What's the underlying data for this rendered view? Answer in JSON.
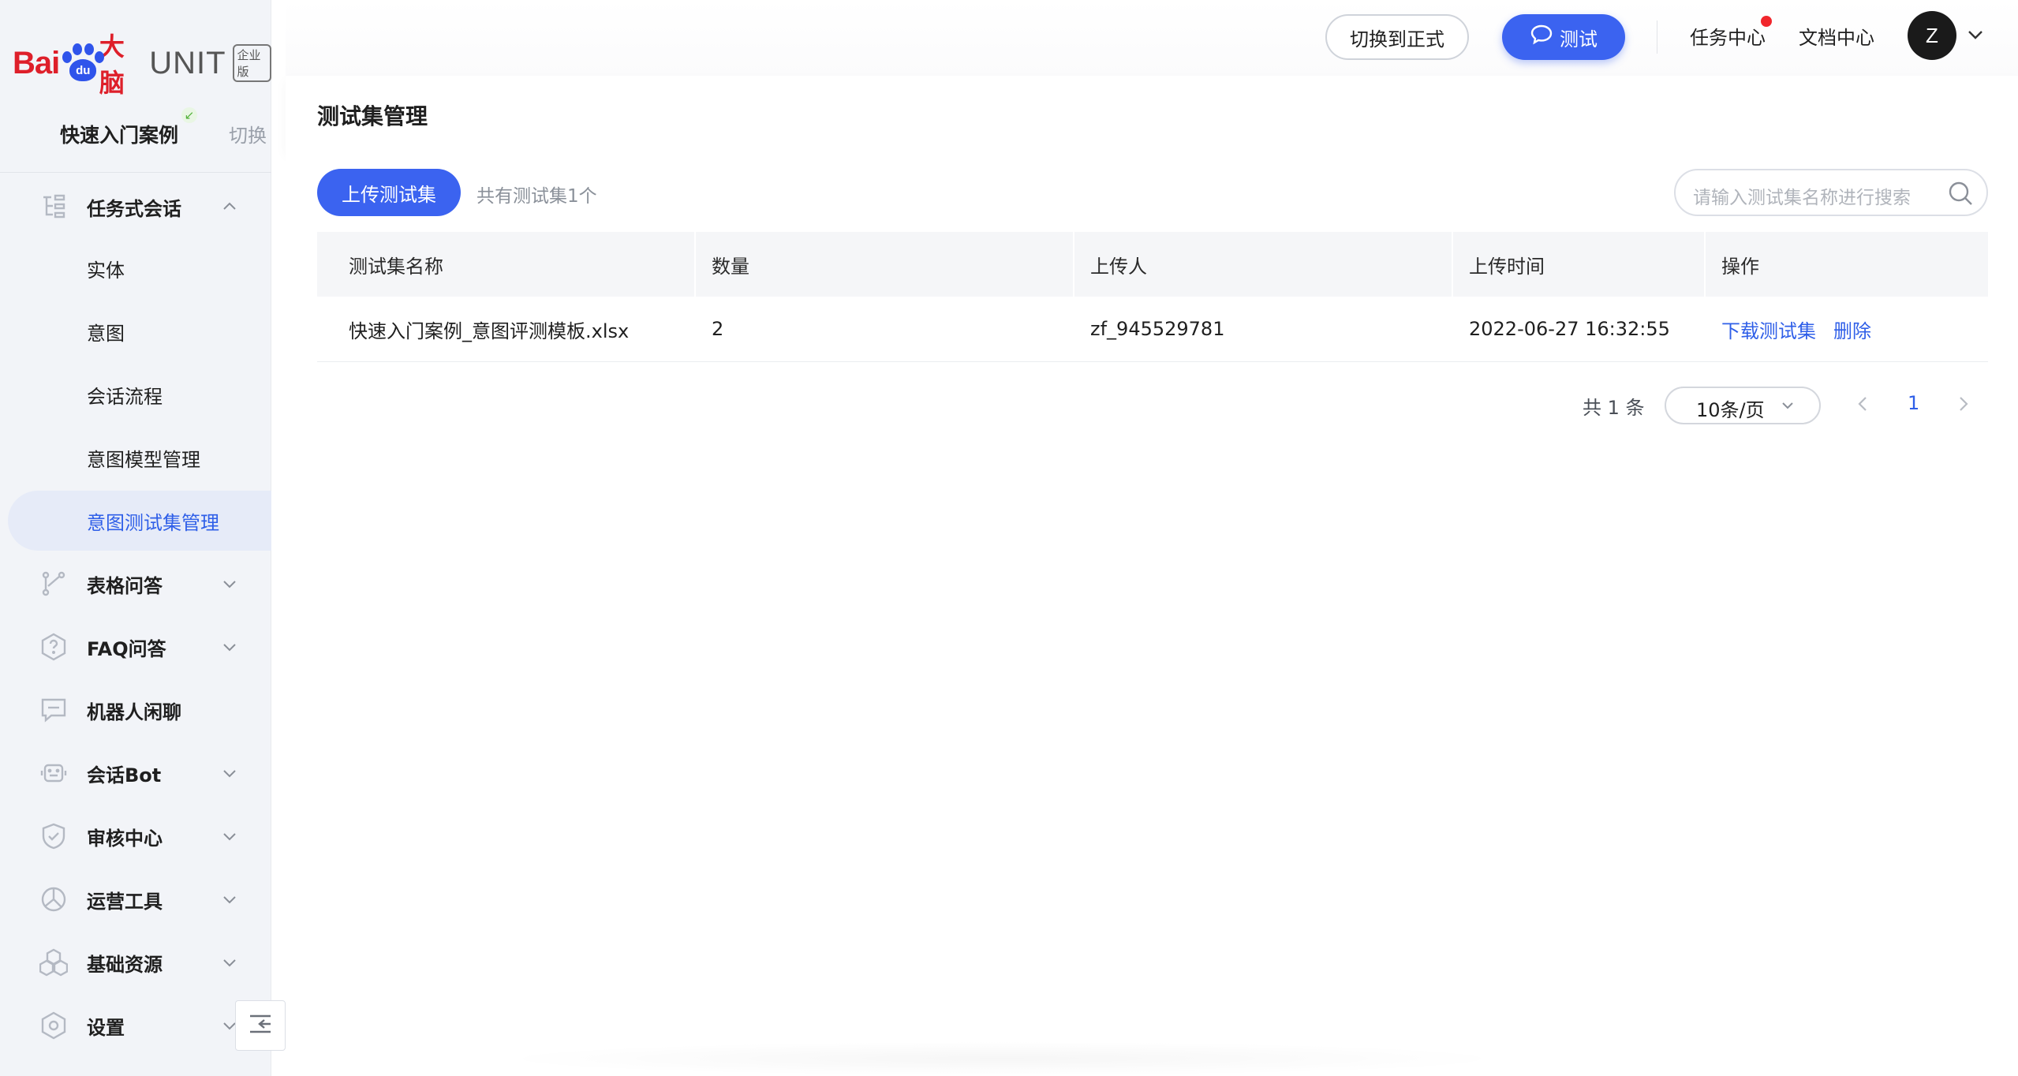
{
  "brand": {
    "logo_bai": "Bai",
    "logo_du": "du",
    "logo_danao": "大脑",
    "logo_unit": "UNIT",
    "logo_badge": "企业版"
  },
  "project": {
    "name": "快速入门案例",
    "switch_label": "切换"
  },
  "sidebar": {
    "items": [
      {
        "label": "任务式会话",
        "icon": "tree-icon",
        "expanded": true
      },
      {
        "label": "表格问答",
        "icon": "branch-icon",
        "expanded": false
      },
      {
        "label": "FAQ问答",
        "icon": "question-hexagon-icon",
        "expanded": false
      },
      {
        "label": "机器人闲聊",
        "icon": "chat-window-icon",
        "expanded": false
      },
      {
        "label": "会话Bot",
        "icon": "robot-icon",
        "expanded": false
      },
      {
        "label": "审核中心",
        "icon": "shield-icon",
        "expanded": false
      },
      {
        "label": "运营工具",
        "icon": "pie-chart-icon",
        "expanded": false
      },
      {
        "label": "基础资源",
        "icon": "cubes-icon",
        "expanded": false
      },
      {
        "label": "设置",
        "icon": "hexagon-gear-icon",
        "expanded": false
      }
    ],
    "subitems": [
      {
        "label": "实体"
      },
      {
        "label": "意图"
      },
      {
        "label": "会话流程"
      },
      {
        "label": "意图模型管理"
      },
      {
        "label": "意图测试集管理",
        "active": true
      }
    ]
  },
  "header": {
    "switch_formal": "切换到正式",
    "test_button": "测试",
    "task_center": "任务中心",
    "doc_center": "文档中心",
    "avatar_letter": "Z"
  },
  "main": {
    "title": "测试集管理",
    "upload_button": "上传测试集",
    "count_text": "共有测试集1个",
    "search_placeholder": "请输入测试集名称进行搜索",
    "table": {
      "columns": [
        "测试集名称",
        "数量",
        "上传人",
        "上传时间",
        "操作"
      ],
      "rows": [
        {
          "name": "快速入门案例_意图评测模板.xlsx",
          "count": "2",
          "uploader": "zf_945529781",
          "time": "2022-06-27 16:32:55",
          "actions": [
            "下载测试集",
            "删除"
          ]
        }
      ]
    },
    "pagination": {
      "total": "共 1 条",
      "page_size": "10条/页",
      "current_page": "1"
    }
  },
  "colors": {
    "primary": "#3b63f0",
    "link": "#2f5fe8",
    "brand_red": "#de1f2a",
    "notification_dot": "#f1262c"
  }
}
